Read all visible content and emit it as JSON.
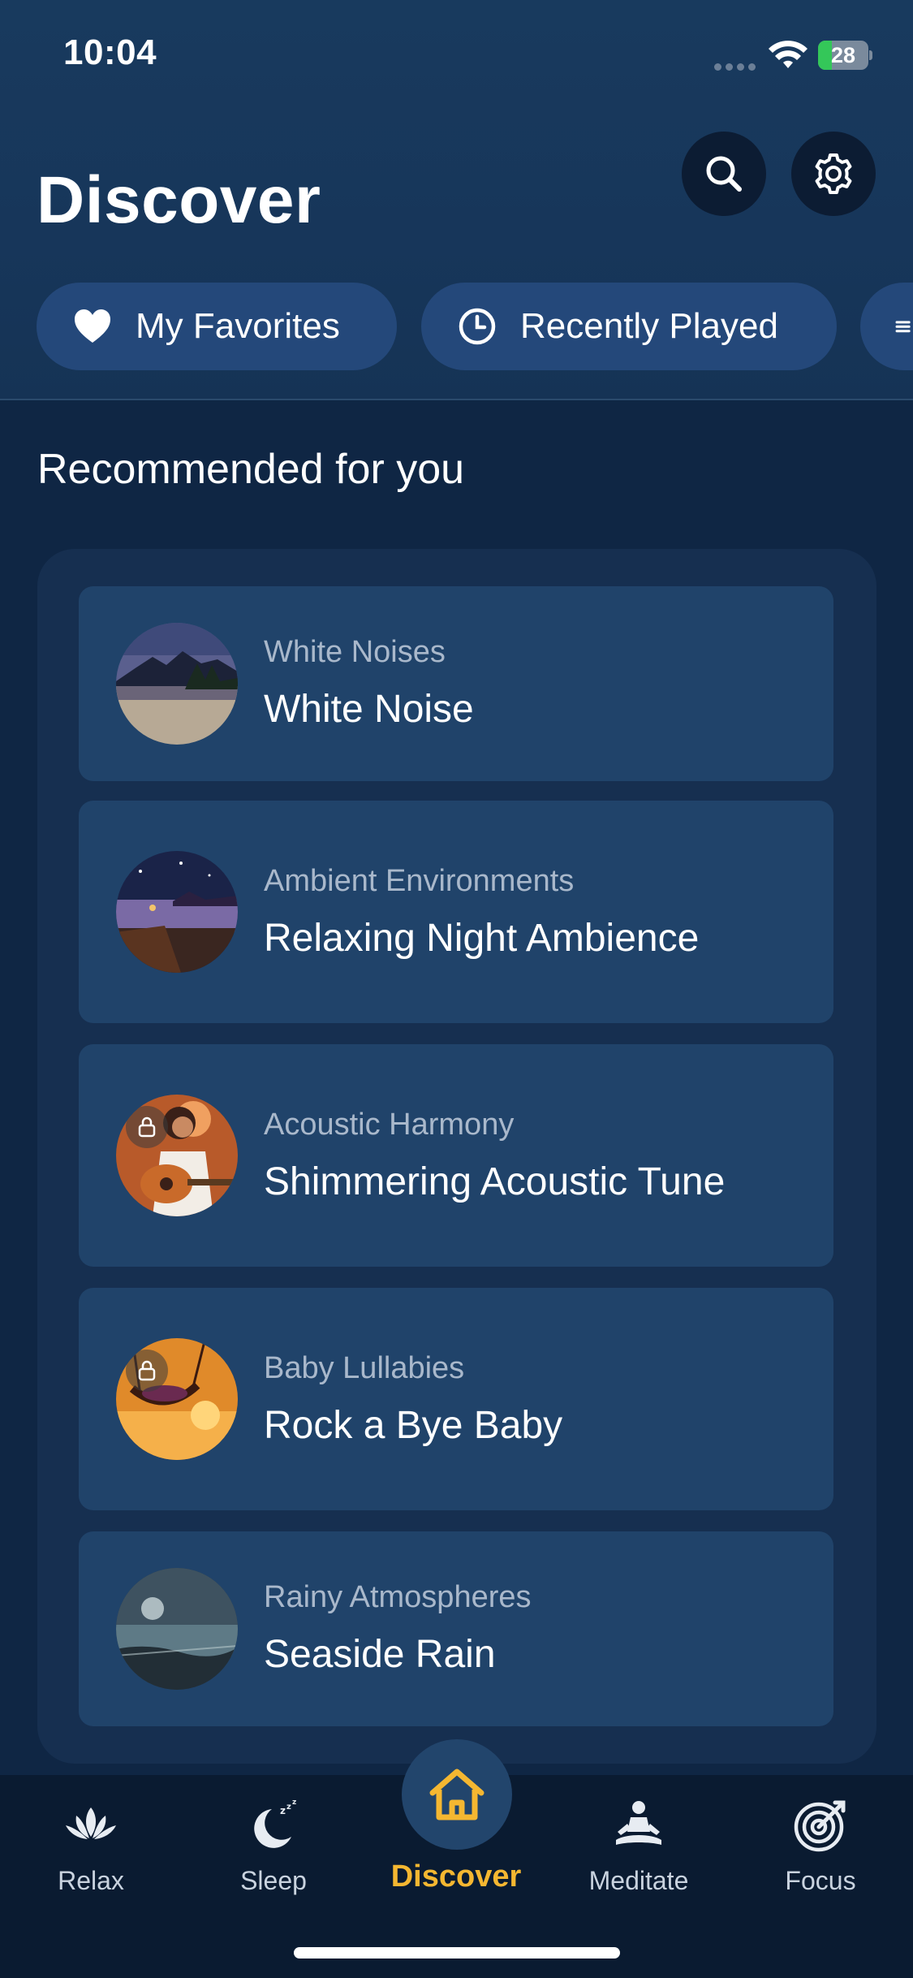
{
  "status_bar": {
    "time": "10:04",
    "battery_percent": "28"
  },
  "header": {
    "title": "Discover"
  },
  "chips": [
    {
      "label": "My Favorites",
      "icon": "heart-icon"
    },
    {
      "label": "Recently Played",
      "icon": "clock-icon"
    },
    {
      "label": "",
      "icon": "list-icon"
    }
  ],
  "section": {
    "title": "Recommended for you"
  },
  "items": [
    {
      "category": "White Noises",
      "title": "White Noise",
      "locked": false
    },
    {
      "category": "Ambient Environments",
      "title": "Relaxing Night Ambience",
      "locked": false
    },
    {
      "category": "Acoustic Harmony",
      "title": "Shimmering Acoustic Tune",
      "locked": true
    },
    {
      "category": "Baby Lullabies",
      "title": "Rock a Bye Baby",
      "locked": true
    },
    {
      "category": "Rainy Atmospheres",
      "title": "Seaside Rain",
      "locked": false
    }
  ],
  "tabs": [
    {
      "label": "Relax",
      "icon": "lotus-icon"
    },
    {
      "label": "Sleep",
      "icon": "moon-zzz-icon"
    },
    {
      "label": "Discover",
      "icon": "home-icon",
      "active": true
    },
    {
      "label": "Meditate",
      "icon": "meditation-icon"
    },
    {
      "label": "Focus",
      "icon": "target-icon"
    }
  ],
  "colors": {
    "accent": "#f5b731",
    "background": "#0f2644",
    "card": "#20436a",
    "chip": "#24487a"
  }
}
